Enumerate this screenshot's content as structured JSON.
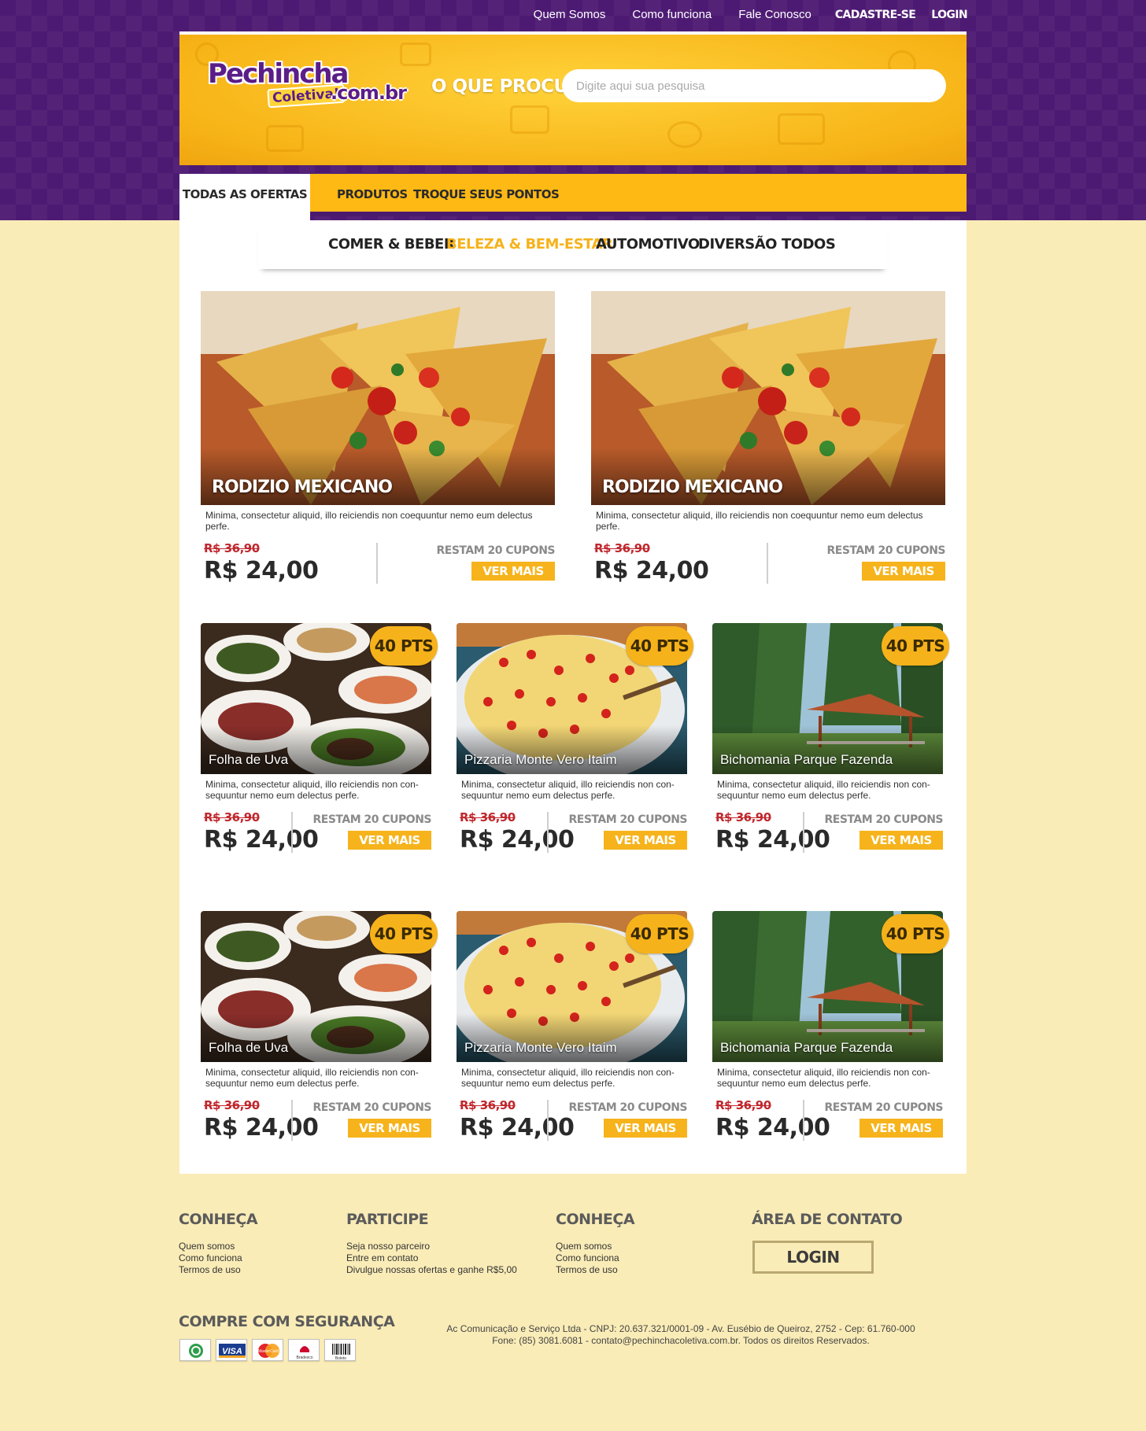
{
  "topnav": {
    "quem_somos": "Quem Somos",
    "como_funciona": "Como funciona",
    "fale_conosco": "Fale Conosco",
    "cadastre": "CADASTRE-SE",
    "login": "LOGIN"
  },
  "logo": {
    "line1": "Pechincha",
    "line2": "Coletiva!",
    "line3": ".com.br"
  },
  "search": {
    "label": "O QUE PROCURA?",
    "placeholder": "Digite aqui sua pesquisa"
  },
  "mainnav": {
    "todas": "TODAS AS OFERTAS",
    "produtos": "PRODUTOS",
    "troque": "TROQUE SEUS PONTOS"
  },
  "categories": [
    "COMER & BEBER",
    "BELEZA & BEM-ESTAR",
    "AUTOMOTIVO",
    "DIVERSÃO",
    "TODOS"
  ],
  "active_category": "BELEZA & BEM-ESTAR",
  "featured": [
    {
      "title": "RODIZIO MEXICANO",
      "desc": "Minima, consectetur aliquid, illo reiciendis non coequuntur nemo eum delectus perfe.",
      "old_price": "R$ 36,90",
      "price": "R$ 24,00",
      "restam": "RESTAM 20 CUPONS",
      "button": "VER MAIS",
      "image": "nachos-photo"
    },
    {
      "title": "RODIZIO MEXICANO",
      "desc": "Minima, consectetur aliquid, illo reiciendis non coequuntur nemo eum delectus perfe.",
      "old_price": "R$ 36,90",
      "price": "R$ 24,00",
      "restam": "RESTAM 20 CUPONS",
      "button": "VER MAIS",
      "image": "nachos-photo"
    }
  ],
  "grid": [
    {
      "title": "Folha de Uva",
      "pts": "40 PTS",
      "desc": "Minima, consectetur aliquid, illo reiciendis non con-sequuntur nemo eum delectus perfe.",
      "old_price": "R$ 36,90",
      "price": "R$ 24,00",
      "restam": "RESTAM 20 CUPONS",
      "button": "VER MAIS",
      "image": "arab-food-photo"
    },
    {
      "title": "Pizzaria Monte Vero Itaim",
      "pts": "40 PTS",
      "desc": "Minima, consectetur aliquid, illo reiciendis non con-sequuntur nemo eum delectus perfe.",
      "old_price": "R$ 36,90",
      "price": "R$ 24,00",
      "restam": "RESTAM 20 CUPONS",
      "button": "VER MAIS",
      "image": "pizza-photo"
    },
    {
      "title": "Bichomania Parque Fazenda",
      "pts": "40 PTS",
      "desc": "Minima, consectetur aliquid, illo reiciendis non con-sequuntur nemo eum delectus perfe.",
      "old_price": "R$ 36,90",
      "price": "R$ 24,00",
      "restam": "RESTAM 20 CUPONS",
      "button": "VER MAIS",
      "image": "farm-photo"
    },
    {
      "title": "Folha de Uva",
      "pts": "40 PTS",
      "desc": "Minima, consectetur aliquid, illo reiciendis non con-sequuntur nemo eum delectus perfe.",
      "old_price": "R$ 36,90",
      "price": "R$ 24,00",
      "restam": "RESTAM 20 CUPONS",
      "button": "VER MAIS",
      "image": "arab-food-photo"
    },
    {
      "title": "Pizzaria Monte Vero Itaim",
      "pts": "40 PTS",
      "desc": "Minima, consectetur aliquid, illo reiciendis non con-sequuntur nemo eum delectus perfe.",
      "old_price": "R$ 36,90",
      "price": "R$ 24,00",
      "restam": "RESTAM 20 CUPONS",
      "button": "VER MAIS",
      "image": "pizza-photo"
    },
    {
      "title": "Bichomania Parque Fazenda",
      "pts": "40 PTS",
      "desc": "Minima, consectetur aliquid, illo reiciendis non con-sequuntur nemo eum delectus perfe.",
      "old_price": "R$ 36,90",
      "price": "R$ 24,00",
      "restam": "RESTAM 20 CUPONS",
      "button": "VER MAIS",
      "image": "farm-photo"
    }
  ],
  "footer": {
    "col1": {
      "title": "CONHEÇA",
      "links": [
        "Quem somos",
        "Como funciona",
        "Termos de uso"
      ]
    },
    "col2": {
      "title": "PARTICIPE",
      "links": [
        "Seja nosso parceiro",
        "Entre em contato",
        "Divulgue nossas ofertas e ganhe R$5,00"
      ]
    },
    "col3": {
      "title": "CONHEÇA",
      "links": [
        "Quem somos",
        "Como funciona",
        "Termos de uso"
      ]
    },
    "col4": {
      "title": "ÁREA DE CONTATO",
      "login": "LOGIN"
    },
    "secure_title": "COMPRE COM SEGURANÇA",
    "payment_icons": [
      "payment-seal-icon",
      "visa-icon",
      "mastercard-icon",
      "bradesco-icon",
      "boleto-icon"
    ],
    "payment_labels": {
      "visa": "VISA",
      "mastercard": "MasterCard",
      "bradesco": "Bradesco",
      "boleto": "Boleto"
    },
    "legal_line1": "Ac Comunicação e Serviço Ltda - CNPJ: 20.637.321/0001-09 - Av. Eusébio de Queiroz, 2752 - Cep: 61.760-000",
    "legal_line2": "Fone: (85) 3081.6081 - contato@pechinchacoletiva.com.br. Todos os direitos Reservados."
  },
  "colors": {
    "purple": "#4d1a73",
    "yellow": "#f6b21b",
    "cream": "#faecb7",
    "price_red": "#c0272d"
  }
}
